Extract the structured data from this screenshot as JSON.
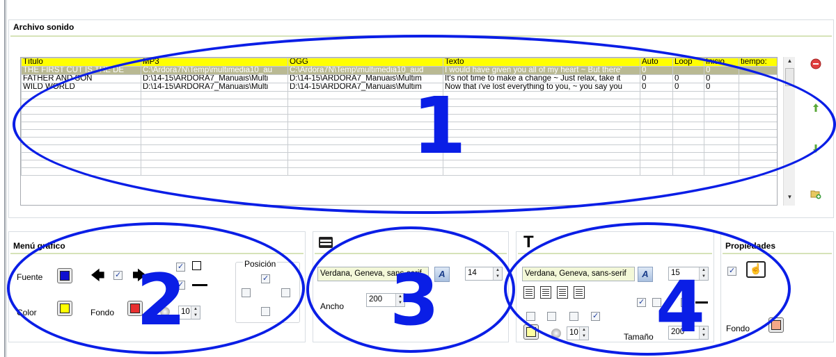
{
  "sound_panel": {
    "title": "Archivo sonido",
    "columns": [
      "Título",
      "MP3",
      "OGG",
      "Texto",
      "Auto",
      "Loop",
      "Inicio",
      "tiempo:"
    ],
    "rows": [
      [
        "THE FIRST CUT IS THE DE",
        "C:\\Ardora7N\\Temp\\multimedia10_au",
        "C:\\Ardora7N\\Temp\\multimedia10_aud",
        "I would have given you all of my heart ~ But there'",
        "0",
        "",
        "0",
        ""
      ],
      [
        "FATHER AND SON",
        "D:\\14-15\\ARDORA7_Manuais\\Multi",
        "D:\\14-15\\ARDORA7_Manuais\\Multim",
        "It's not time to make a change ~ Just relax, take it",
        "0",
        "0",
        "0",
        ""
      ],
      [
        "WILD WORLD",
        "D:\\14-15\\ARDORA7_Manuais\\Multi",
        "D:\\14-15\\ARDORA7_Manuais\\Multim",
        "Now that i've lost everything to you, ~ you say you",
        "0",
        "0",
        "0",
        ""
      ]
    ],
    "empty_rows": 11
  },
  "side_icons": [
    "remove-icon",
    "move-up-icon",
    "move-down-icon",
    "add-folder-icon"
  ],
  "menu_panel": {
    "title": "Menú gráfico",
    "fuente_label": "Fuente",
    "color_label": "Color",
    "fondo_label": "Fondo",
    "posicion_label": "Posición",
    "width_value": "10",
    "fuente_color": "#1010d0",
    "color_color": "#ffff00",
    "fondo_color": "#e83030"
  },
  "text_panel": {
    "font": "Verdana, Geneva, sans-serif",
    "size_value": "14",
    "ancho_label": "Ancho",
    "ancho_value": "200"
  },
  "title_panel": {
    "font": "Verdana, Geneva, sans-serif",
    "size_value": "15",
    "width_value": "10",
    "tamano_label": "Tamaño",
    "tamano_value": "200",
    "bg_color": "#ffffa0"
  },
  "props_panel": {
    "title": "Propiedades",
    "fondo_label": "Fondo",
    "fondo_color": "#f4a888"
  },
  "annotations": [
    "1",
    "2",
    "3",
    "4"
  ],
  "annotation_color": "#0a1ee6"
}
